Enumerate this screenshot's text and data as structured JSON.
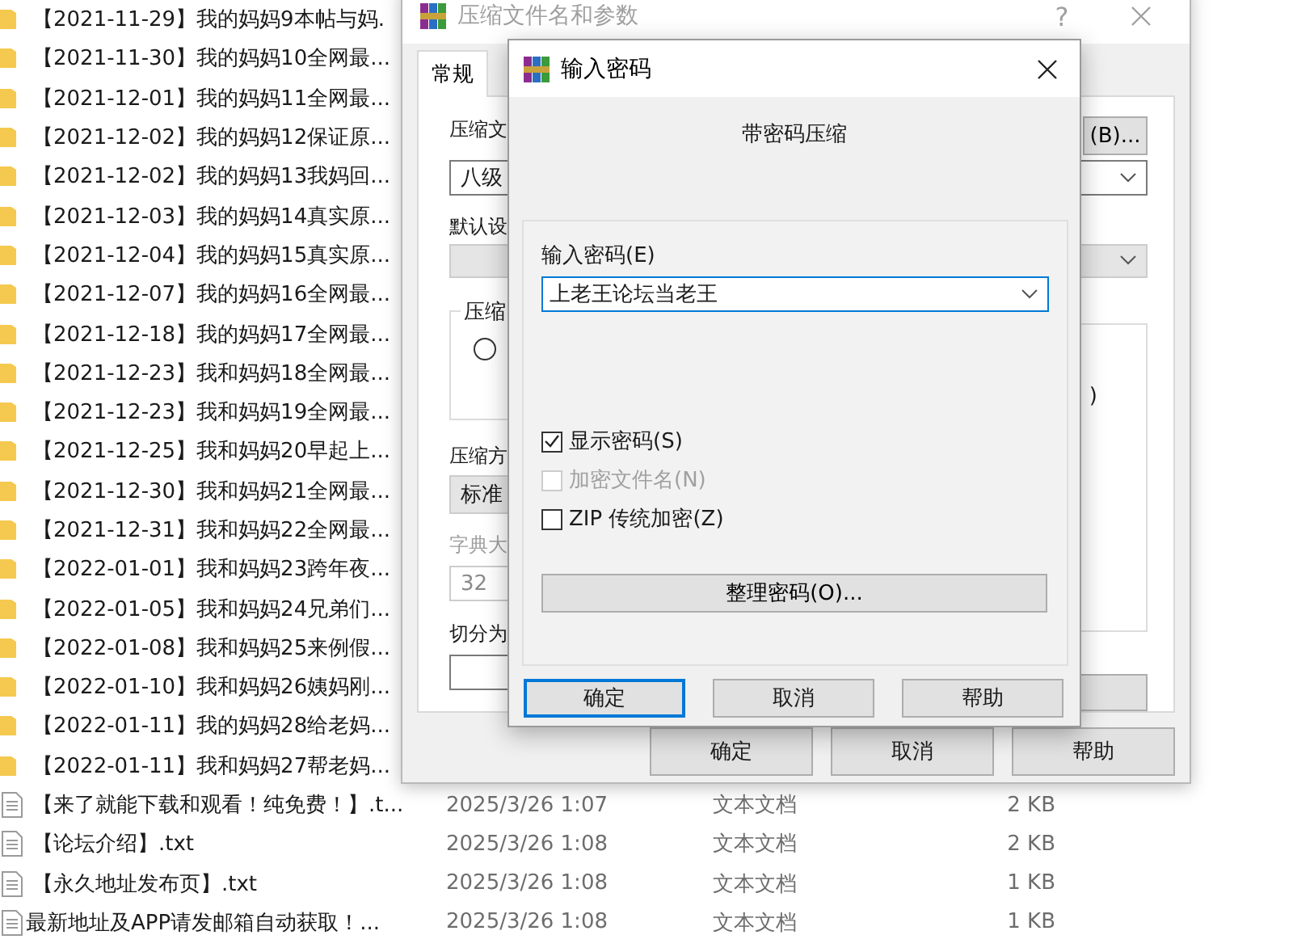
{
  "file_list": [
    {
      "kind": "folder",
      "name": "【2021-11-29】我的妈妈9本帖与妈."
    },
    {
      "kind": "folder",
      "name": "【2021-11-30】我的妈妈10全网最..."
    },
    {
      "kind": "folder",
      "name": "【2021-12-01】我的妈妈11全网最..."
    },
    {
      "kind": "folder",
      "name": "【2021-12-02】我的妈妈12保证原..."
    },
    {
      "kind": "folder",
      "name": "【2021-12-02】我的妈妈13我妈回..."
    },
    {
      "kind": "folder",
      "name": "【2021-12-03】我的妈妈14真实原..."
    },
    {
      "kind": "folder",
      "name": "【2021-12-04】我的妈妈15真实原..."
    },
    {
      "kind": "folder",
      "name": "【2021-12-07】我的妈妈16全网最..."
    },
    {
      "kind": "folder",
      "name": "【2021-12-18】我的妈妈17全网最..."
    },
    {
      "kind": "folder",
      "name": "【2021-12-23】我和妈妈18全网最..."
    },
    {
      "kind": "folder",
      "name": "【2021-12-23】我和妈妈19全网最..."
    },
    {
      "kind": "folder",
      "name": "【2021-12-25】我和妈妈20早起上..."
    },
    {
      "kind": "folder",
      "name": "【2021-12-30】我和妈妈21全网最..."
    },
    {
      "kind": "folder",
      "name": "【2021-12-31】我和妈妈22全网最..."
    },
    {
      "kind": "folder",
      "name": "【2022-01-01】我和妈妈23跨年夜..."
    },
    {
      "kind": "folder",
      "name": "【2022-01-05】我和妈妈24兄弟们..."
    },
    {
      "kind": "folder",
      "name": "【2022-01-08】我和妈妈25来例假..."
    },
    {
      "kind": "folder",
      "name": "【2022-01-10】我和妈妈26姨妈刚..."
    },
    {
      "kind": "folder",
      "name": "【2022-01-11】我的妈妈28给老妈..."
    },
    {
      "kind": "folder",
      "name": "【2022-01-11】我和妈妈27帮老妈..."
    },
    {
      "kind": "text_file",
      "name": "【来了就能下载和观看！纯免费！】.t...",
      "modified": "2025/3/26 1:07",
      "type": "文本文档",
      "size": "2 KB"
    },
    {
      "kind": "text_file",
      "name": "【论坛介绍】.txt",
      "modified": "2025/3/26 1:08",
      "type": "文本文档",
      "size": "2 KB"
    },
    {
      "kind": "text_file",
      "name": "【永久地址发布页】.txt",
      "modified": "2025/3/26 1:08",
      "type": "文本文档",
      "size": "1 KB"
    },
    {
      "kind": "text_file",
      "name": "最新地址及APP请发邮箱自动获取！...",
      "modified": "2025/3/26 1:08",
      "type": "文本文档",
      "size": "1 KB"
    }
  ],
  "archive_dialog": {
    "title": "压缩文件名和参数",
    "help_button": "?",
    "tabs": [
      {
        "label": "常规",
        "selected": true
      }
    ],
    "archive_name_label": "压缩文",
    "browse_button": "(B)...",
    "archive_name_value": "八级",
    "profile_label": "默认设",
    "format_group": {
      "title": "压缩",
      "radio_selected": false
    },
    "options_group": {
      "text": ")"
    },
    "method_label": "压缩方",
    "method_value": "标准",
    "dictionary_label": "字典大",
    "dictionary_value": "32",
    "dictionary_disabled": true,
    "split_label": "切分为",
    "buttons": [
      "确定",
      "取消",
      "帮助"
    ]
  },
  "password_dialog": {
    "title": "输入密码",
    "heading": "带密码压缩",
    "password_label": "输入密码(E)",
    "password_value": "上老王论坛当老王",
    "options": [
      {
        "label": "显示密码(S)",
        "checked": true,
        "disabled": false
      },
      {
        "label": "加密文件名(N)",
        "checked": false,
        "disabled": true
      },
      {
        "label": "ZIP 传统加密(Z)",
        "checked": false,
        "disabled": false
      }
    ],
    "organize_button": "整理密码(O)...",
    "buttons": [
      {
        "label": "确定",
        "default": true
      },
      {
        "label": "取消",
        "default": false
      },
      {
        "label": "帮助",
        "default": false
      }
    ]
  }
}
